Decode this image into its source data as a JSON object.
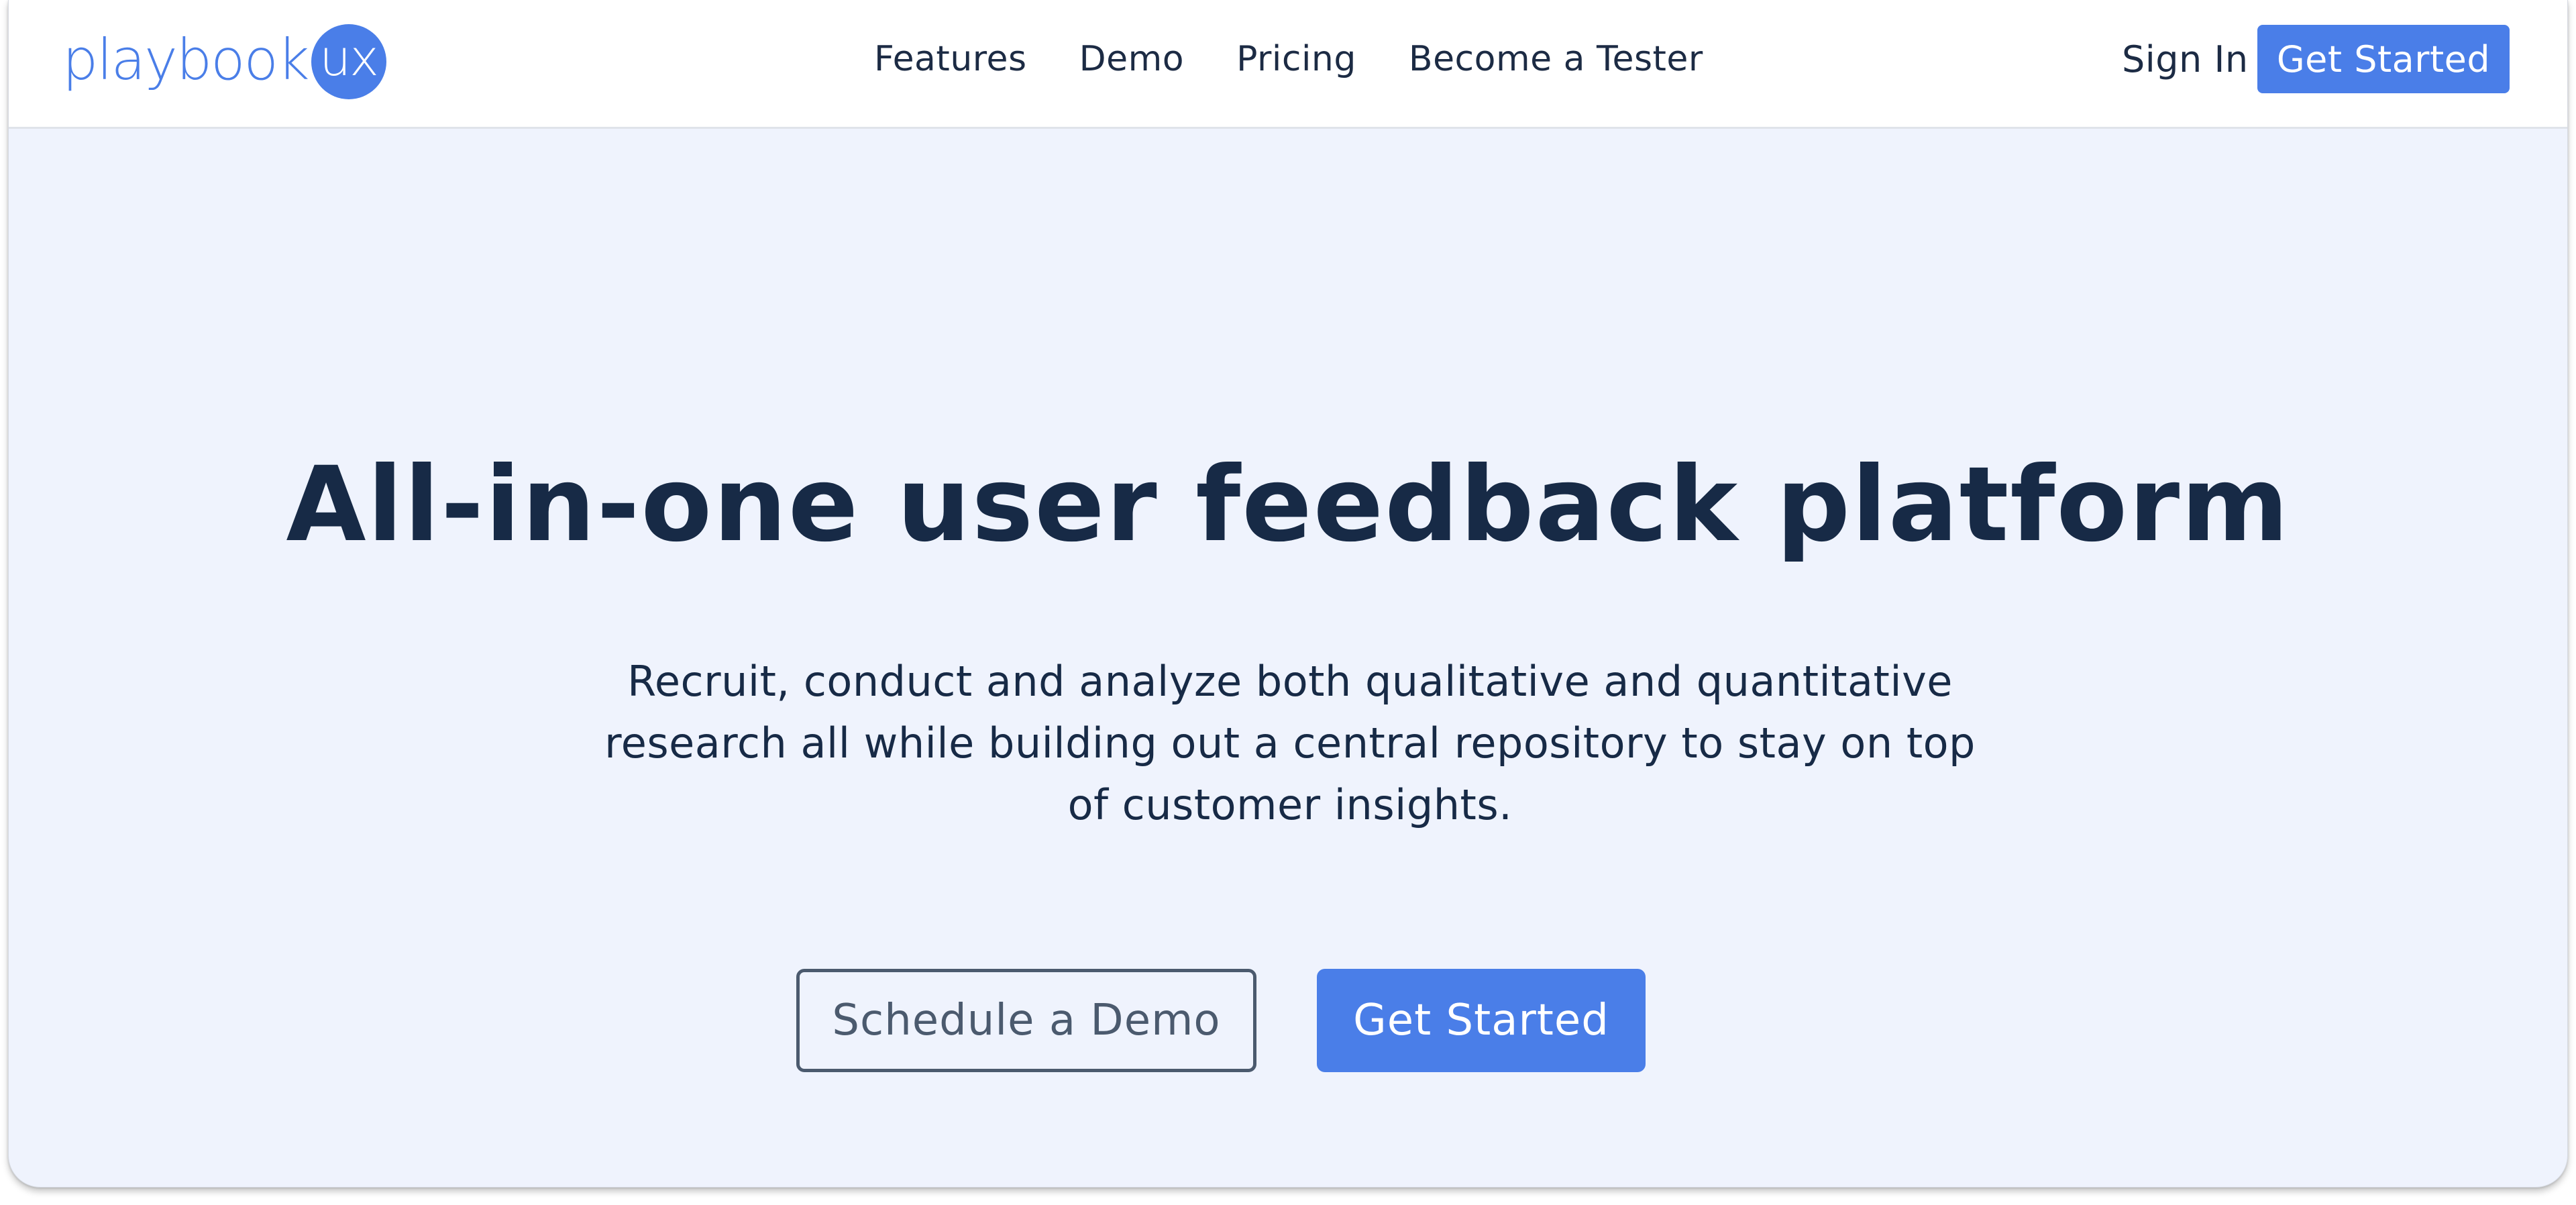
{
  "brand": {
    "name": "playbook",
    "badge": "ux",
    "color": "#4a7ee8"
  },
  "nav": {
    "links": [
      {
        "label": "Features"
      },
      {
        "label": "Demo"
      },
      {
        "label": "Pricing"
      },
      {
        "label": "Become a Tester"
      }
    ],
    "sign_in": "Sign In",
    "cta": "Get Started"
  },
  "hero": {
    "title": "All-in-one user feedback platform",
    "subtitle": "Recruit, conduct and analyze both qualitative and quantitative research all while building out a central repository to stay on top of customer insights.",
    "secondary_button": "Schedule a Demo",
    "primary_button": "Get Started"
  },
  "colors": {
    "accent": "#4a7ee8",
    "hero_background": "#eff3fd",
    "heading_text": "#172a46",
    "outline_button": "#4b5a6e"
  }
}
